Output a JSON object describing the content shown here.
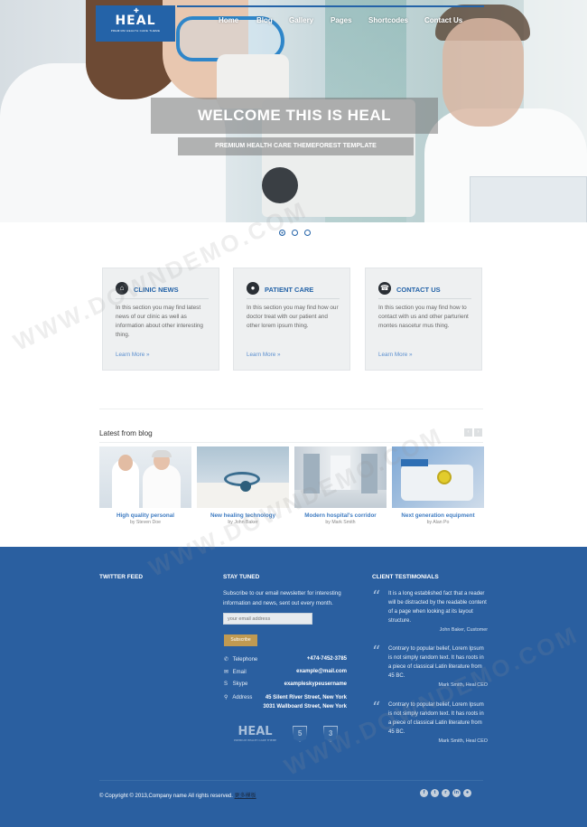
{
  "logo": {
    "text": "HEAL",
    "sub": "PREMIUM HEALTH CARE THEME"
  },
  "nav": [
    "Home",
    "Blog",
    "Gallery",
    "Pages",
    "Shortcodes",
    "Contact Us"
  ],
  "hero": {
    "title": "WELCOME THIS IS HEAL",
    "tagline": "PREMIUM HEALTH CARE THEMEFOREST TEMPLATE",
    "slides": 3,
    "active_slide": 1
  },
  "features": [
    {
      "title": "CLINIC NEWS",
      "icon": "home-icon",
      "desc": "In this section you may find latest news of our clinic as well as information about other interesting thing.",
      "more": "Learn More »"
    },
    {
      "title": "PATIENT CARE",
      "icon": "chat-icon",
      "desc": "In this section you may find how our doctor treat with our patient and other lorem ipsum thing.",
      "more": "Learn More »"
    },
    {
      "title": "CONTACT US",
      "icon": "phone-icon",
      "desc": "In this section you may find how to contact with us and other parturient montes nascetur mus thing.",
      "more": "Learn More »"
    }
  ],
  "blog": {
    "heading": "Latest from blog",
    "posts": [
      {
        "title": "High quality personal",
        "author": "by Steven Doe"
      },
      {
        "title": "New healing technology",
        "author": "by John Baker"
      },
      {
        "title": "Modern hospital's corridor",
        "author": "by Mark Smith"
      },
      {
        "title": "Next generation equipment",
        "author": "by Alan Po"
      }
    ]
  },
  "footer": {
    "twitter_heading": "TWITTER FEED",
    "stay_heading": "STAY TUNED",
    "stay_text": "Subscribe to our email newsletter for interesting information and news, sent out every month.",
    "email_placeholder": "your email address",
    "subscribe_label": "Subscribe",
    "contacts": [
      {
        "icon": "phone-icon",
        "label": "Telephone",
        "value": "+474-7452-3785"
      },
      {
        "icon": "mail-icon",
        "label": "Email",
        "value": "example@mail.com"
      },
      {
        "icon": "skype-icon",
        "label": "Skype",
        "value": "exampleskypeusername"
      },
      {
        "icon": "location-icon",
        "label": "Address",
        "value": "45 Silent River Street, New York",
        "value2": "3031 Wallboard Street, New York"
      }
    ],
    "testimonials_heading": "CLIENT TESTIMONIALS",
    "testimonials": [
      {
        "text": "It is a long established fact that a reader will be distracted by the readable content of a page when looking at its layout structure.",
        "author": "John Baker, Customer"
      },
      {
        "text": "Contrary to popular belief, Lorem Ipsum is not simply random text. It has roots in a piece of classical Latin literature from 45 BC.",
        "author": "Mark Smith, Heal CEO"
      },
      {
        "text": "Contrary to popular belief, Lorem Ipsum is not simply random text. It has roots in a piece of classical Latin literature from 45 BC.",
        "author": "Mark Smith, Heal CEO"
      }
    ],
    "footer_logo": "HEAL",
    "footer_logo_sub": "PREMIUM HEALTH CARE THEME",
    "copyright": "© Copyright © 2013,Company name All rights reserved.",
    "copyright_link": "更多模板",
    "watermark": "WWW.DOWNDEMO.COM"
  },
  "colors": {
    "brand": "#2463a8",
    "footer": "#2a5fa0",
    "accent": "#c09a52"
  }
}
